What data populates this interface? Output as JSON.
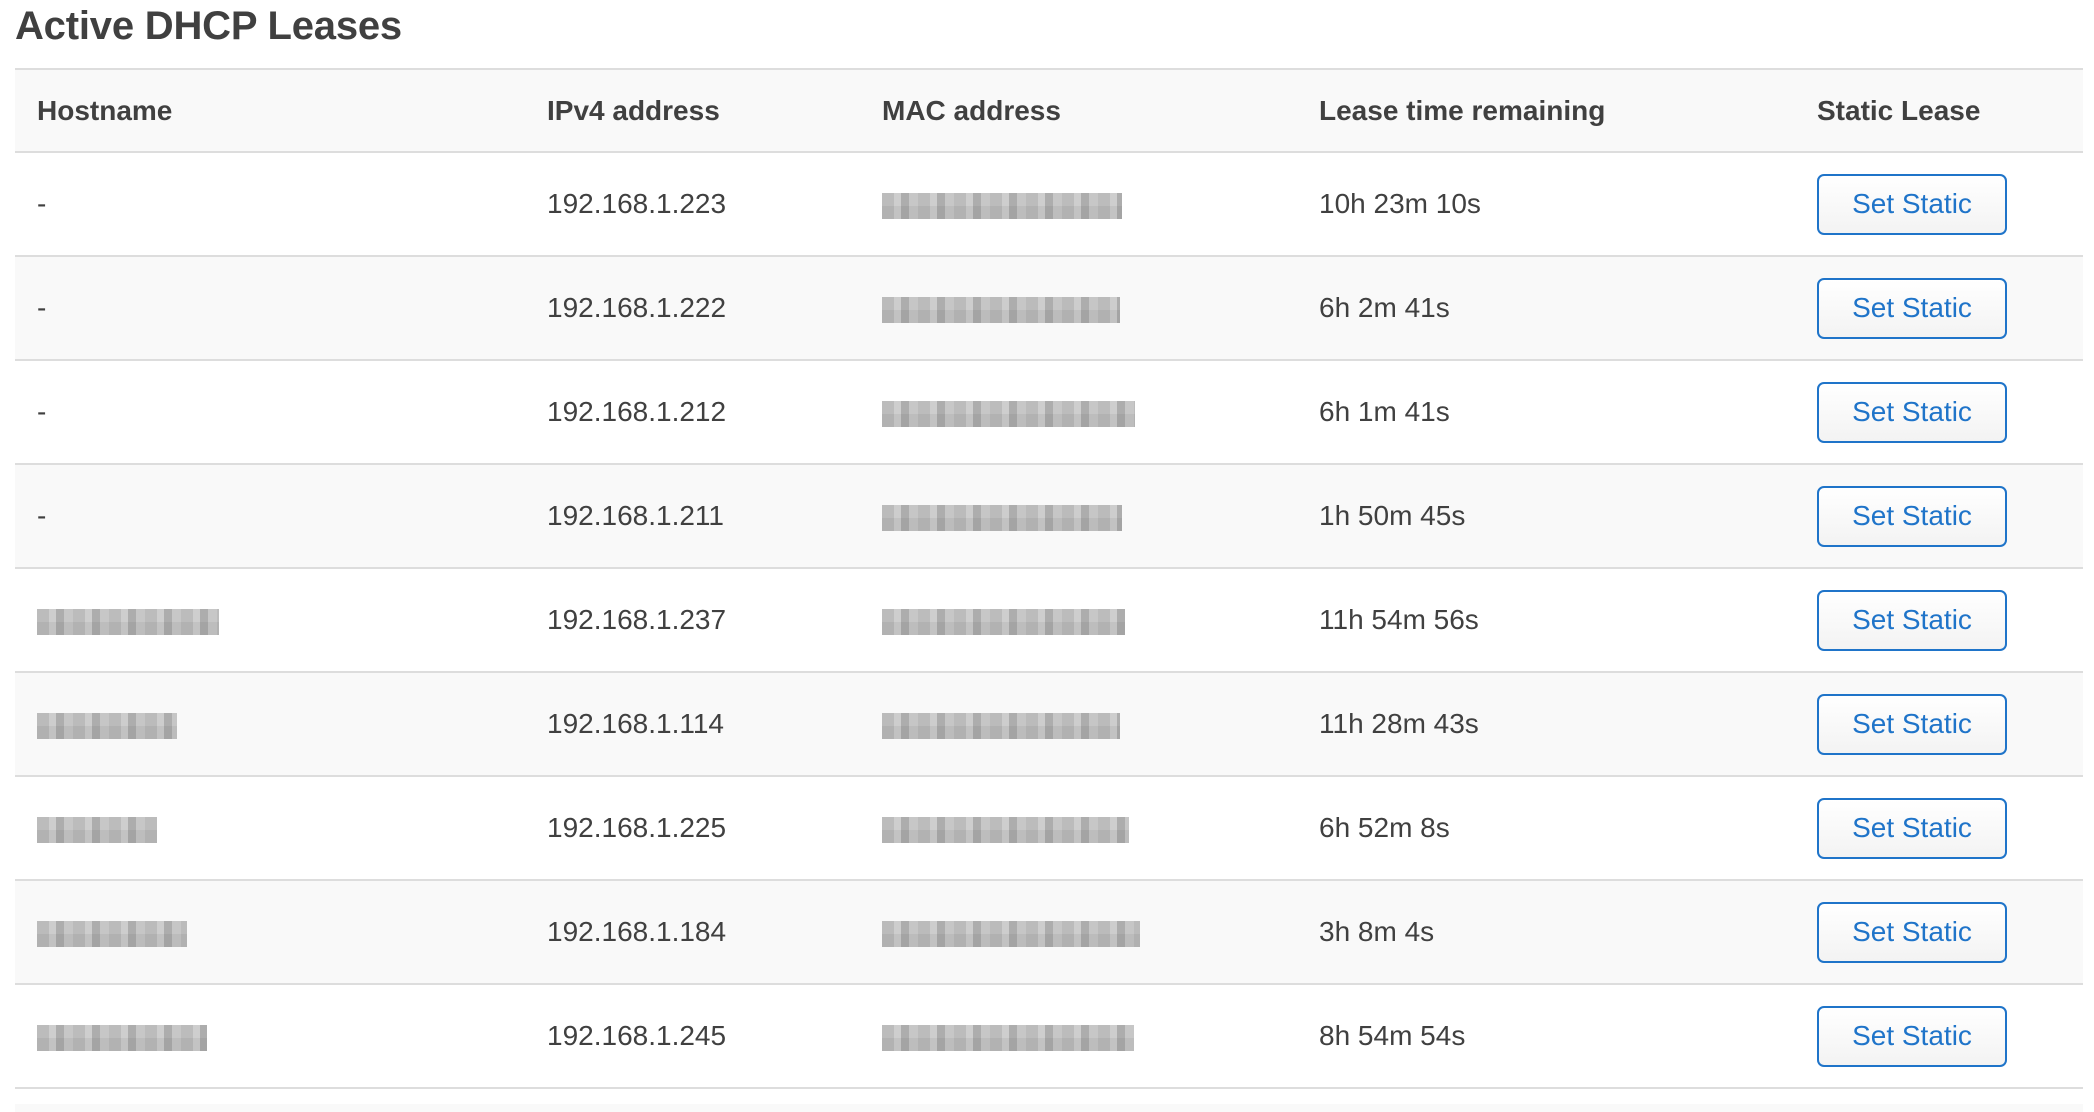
{
  "page": {
    "title": "Active DHCP Leases"
  },
  "table": {
    "columns": {
      "hostname": "Hostname",
      "ipv4": "IPv4 address",
      "mac": "MAC address",
      "lease_time": "Lease time remaining",
      "static_lease": "Static Lease"
    },
    "rows": [
      {
        "hostname": "-",
        "hostname_redacted": false,
        "ipv4": "192.168.1.223",
        "mac_redacted": true,
        "lease_time": "10h 23m 10s",
        "action": "Set Static"
      },
      {
        "hostname": "-",
        "hostname_redacted": false,
        "ipv4": "192.168.1.222",
        "mac_redacted": true,
        "lease_time": "6h 2m 41s",
        "action": "Set Static"
      },
      {
        "hostname": "-",
        "hostname_redacted": false,
        "ipv4": "192.168.1.212",
        "mac_redacted": true,
        "lease_time": "6h 1m 41s",
        "action": "Set Static"
      },
      {
        "hostname": "-",
        "hostname_redacted": false,
        "ipv4": "192.168.1.211",
        "mac_redacted": true,
        "lease_time": "1h 50m 45s",
        "action": "Set Static"
      },
      {
        "hostname": "",
        "hostname_redacted": true,
        "ipv4": "192.168.1.237",
        "mac_redacted": true,
        "lease_time": "11h 54m 56s",
        "action": "Set Static"
      },
      {
        "hostname": "",
        "hostname_redacted": true,
        "ipv4": "192.168.1.114",
        "mac_redacted": true,
        "lease_time": "11h 28m 43s",
        "action": "Set Static"
      },
      {
        "hostname": "",
        "hostname_redacted": true,
        "ipv4": "192.168.1.225",
        "mac_redacted": true,
        "lease_time": "6h 52m 8s",
        "action": "Set Static"
      },
      {
        "hostname": "",
        "hostname_redacted": true,
        "ipv4": "192.168.1.184",
        "mac_redacted": true,
        "lease_time": "3h 8m 4s",
        "action": "Set Static"
      },
      {
        "hostname": "",
        "hostname_redacted": true,
        "ipv4": "192.168.1.245",
        "mac_redacted": true,
        "lease_time": "8h 54m 54s",
        "action": "Set Static"
      }
    ]
  },
  "colors": {
    "text": "#404040",
    "accent": "#1f74c9",
    "row_alt": "#f9f9f9",
    "border": "#dddddd"
  }
}
